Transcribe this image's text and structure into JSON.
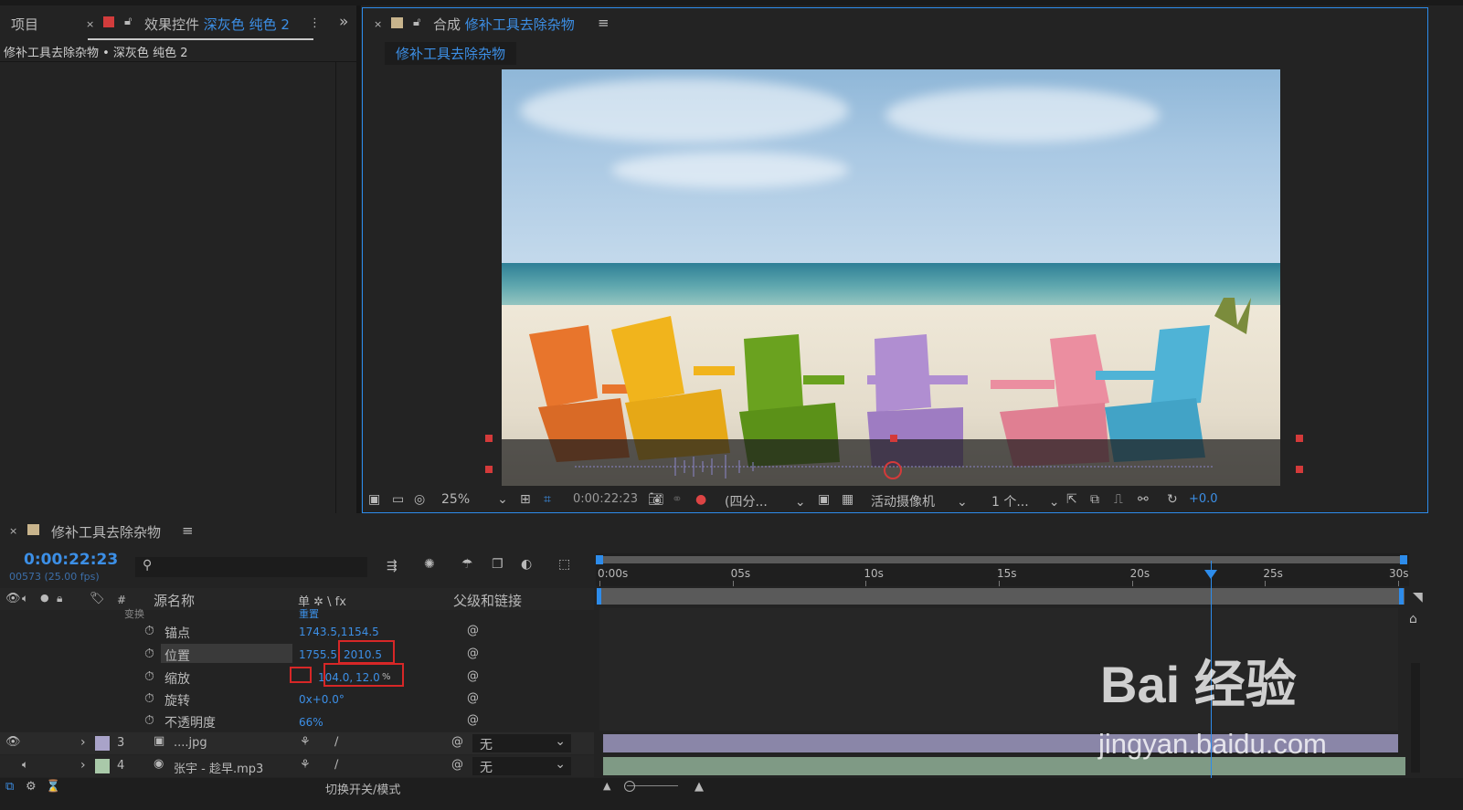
{
  "left_panel": {
    "tab_project": "项目",
    "tab_effects_prefix": "效果控件",
    "tab_effects_layer": "深灰色 纯色 2",
    "breadcrumb": "修补工具去除杂物 • 深灰色 纯色 2"
  },
  "comp_panel": {
    "tab_prefix": "合成",
    "tab_name": "修补工具去除杂物",
    "subtab": "修补工具去除杂物",
    "zoom": "25%",
    "timecode": "0:00:22:23",
    "resolution": "(四分...",
    "camera": "活动摄像机",
    "views": "1 个...",
    "exposure": "+0.0"
  },
  "timeline": {
    "title": "修补工具去除杂物",
    "timecode": "0:00:22:23",
    "frame_info": "00573 (25.00 fps)",
    "search_placeholder": "",
    "col_source": "源名称",
    "col_hash": "#",
    "col_parent": "父级和链接",
    "col_switch_icons": "单 ✲ \\ fx",
    "transform_label": "变换",
    "reset_label": "重置",
    "properties": [
      {
        "label": "锚点",
        "value": "1743.5,1154.5"
      },
      {
        "label": "位置",
        "value_x": "1755.5,",
        "value_y": "2010.5"
      },
      {
        "label": "缩放",
        "value_x": "104.0,",
        "value_y": "12.0",
        "unit": "%"
      },
      {
        "label": "旋转",
        "value": "0x+0.0°"
      },
      {
        "label": "不透明度",
        "value": "66%"
      }
    ],
    "layers": [
      {
        "num": "3",
        "name": "....jpg",
        "parent": "无",
        "color": "#a9a3c9"
      },
      {
        "num": "4",
        "name": "张宇 - 趁早.mp3",
        "parent": "无",
        "color": "#a9c9a9"
      }
    ],
    "ruler": [
      "0:00s",
      "05s",
      "10s",
      "15s",
      "20s",
      "25s",
      "30s"
    ],
    "playhead_fraction": 0.766,
    "bottom_toggle": "切换开关/模式"
  },
  "watermark": {
    "text": "Bai 经验",
    "url": "jingyan.baidu.com"
  },
  "colors": {
    "accent": "#3c8fe6",
    "highlight_red": "#d72727",
    "panel_bg": "#232323"
  }
}
